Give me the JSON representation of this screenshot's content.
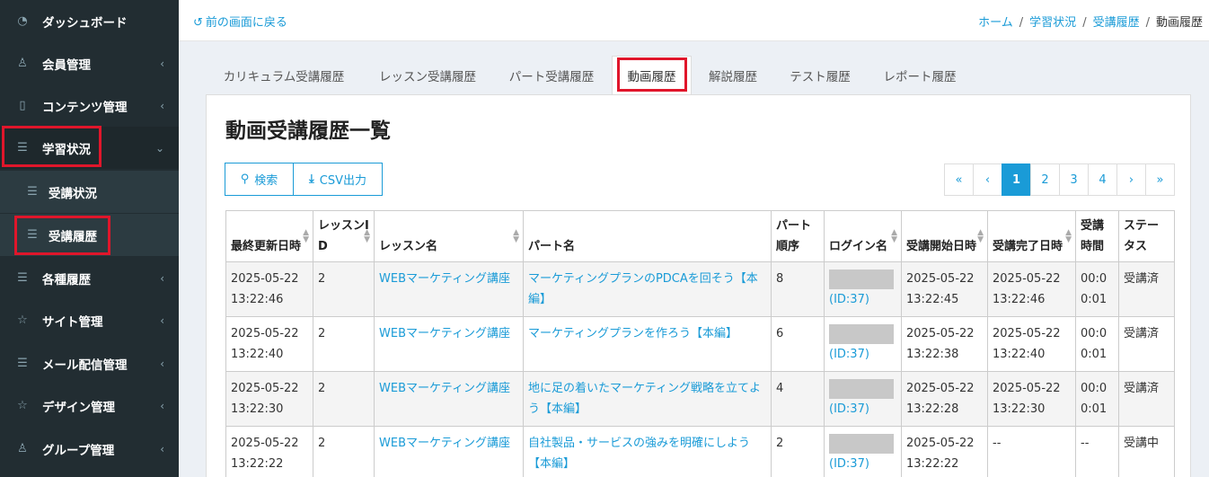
{
  "sidebar": {
    "items": [
      {
        "label": "ダッシュボード",
        "icon": "dashboard-icon",
        "chevron": ""
      },
      {
        "label": "会員管理",
        "icon": "user-icon",
        "chevron": "‹"
      },
      {
        "label": "コンテンツ管理",
        "icon": "book-icon",
        "chevron": "‹"
      },
      {
        "label": "学習状況",
        "icon": "list-icon",
        "chevron": "⌄"
      },
      {
        "label": "受講状況",
        "icon": "list-icon",
        "chevron": ""
      },
      {
        "label": "受講履歴",
        "icon": "list-icon",
        "chevron": ""
      },
      {
        "label": "各種履歴",
        "icon": "list-icon",
        "chevron": "‹"
      },
      {
        "label": "サイト管理",
        "icon": "star-icon",
        "chevron": "‹"
      },
      {
        "label": "メール配信管理",
        "icon": "list-icon",
        "chevron": "‹"
      },
      {
        "label": "デザイン管理",
        "icon": "star-icon",
        "chevron": "‹"
      },
      {
        "label": "グループ管理",
        "icon": "user-icon",
        "chevron": "‹"
      }
    ]
  },
  "topbar": {
    "back_label": "前の画面に戻る",
    "breadcrumb": [
      "ホーム",
      "学習状況",
      "受講履歴",
      "動画履歴"
    ]
  },
  "tabs": [
    "カリキュラム受講履歴",
    "レッスン受講履歴",
    "パート受講履歴",
    "動画履歴",
    "解説履歴",
    "テスト履歴",
    "レポート履歴"
  ],
  "panel": {
    "title": "動画受講履歴一覧",
    "search_label": "検索",
    "csv_label": "CSV出力"
  },
  "pager": [
    "«",
    "‹",
    "1",
    "2",
    "3",
    "4",
    "›",
    "»"
  ],
  "table": {
    "headers": [
      "最終更新日時",
      "レッスンID",
      "レッスン名",
      "パート名",
      "パート順序",
      "ログイン名",
      "受講開始日時",
      "受講完了日時",
      "受講時間",
      "ステータス"
    ],
    "rows": [
      {
        "updated": "2025-05-22 13:22:46",
        "lesson_id": "2",
        "lesson": "WEBマーケティング講座",
        "part": "マーケティングプランのPDCAを回そう【本編】",
        "order": "8",
        "login_id": "(ID:37)",
        "start": "2025-05-22 13:22:45",
        "end": "2025-05-22 13:22:46",
        "time": "00:00:01",
        "status": "受講済"
      },
      {
        "updated": "2025-05-22 13:22:40",
        "lesson_id": "2",
        "lesson": "WEBマーケティング講座",
        "part": "マーケティングプランを作ろう【本編】",
        "order": "6",
        "login_id": "(ID:37)",
        "start": "2025-05-22 13:22:38",
        "end": "2025-05-22 13:22:40",
        "time": "00:00:01",
        "status": "受講済"
      },
      {
        "updated": "2025-05-22 13:22:30",
        "lesson_id": "2",
        "lesson": "WEBマーケティング講座",
        "part": "地に足の着いたマーケティング戦略を立てよう【本編】",
        "order": "4",
        "login_id": "(ID:37)",
        "start": "2025-05-22 13:22:28",
        "end": "2025-05-22 13:22:30",
        "time": "00:00:01",
        "status": "受講済"
      },
      {
        "updated": "2025-05-22 13:22:22",
        "lesson_id": "2",
        "lesson": "WEBマーケティング講座",
        "part": "自社製品・サービスの強みを明確にしよう【本編】",
        "order": "2",
        "login_id": "(ID:37)",
        "start": "2025-05-22 13:22:22",
        "end": "--",
        "time": "--",
        "status": "受講中"
      }
    ]
  },
  "colors": {
    "accent": "#1a9bd7",
    "sidebar": "#222d32",
    "highlight": "#e0162b"
  }
}
